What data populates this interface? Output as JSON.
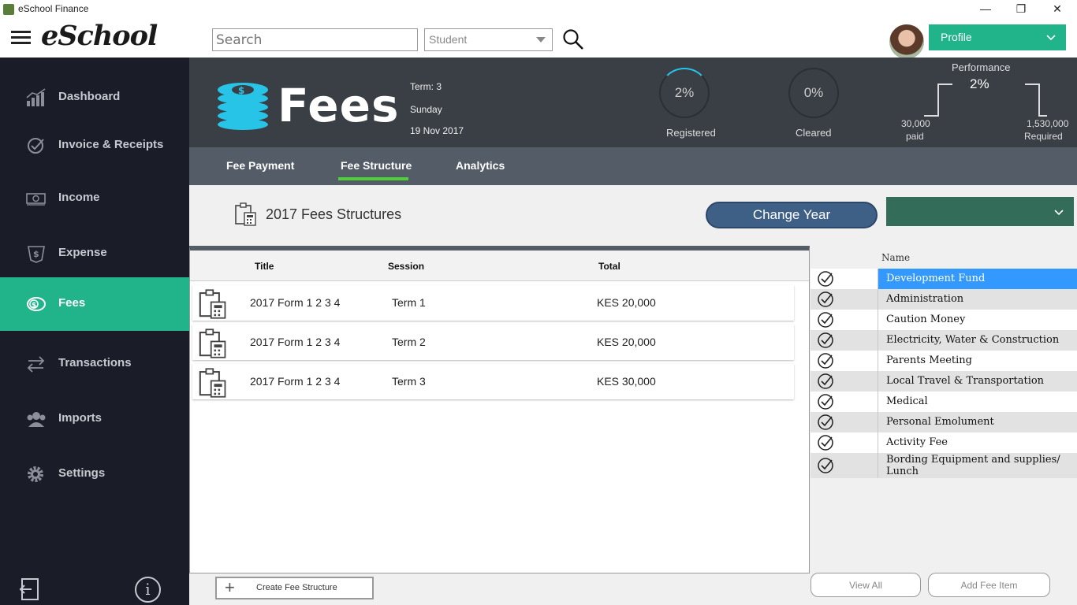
{
  "window": {
    "title": "eSchool Finance",
    "minimize": "—",
    "maximize": "❐",
    "close": "✕"
  },
  "header": {
    "logo": "eSchool",
    "search_placeholder": "Search",
    "filter_value": "Student",
    "profile_label": "Profile"
  },
  "sidebar": {
    "items": [
      {
        "label": "Dashboard",
        "icon": "chart-icon"
      },
      {
        "label": "Invoice & Receipts",
        "icon": "check-circle-icon"
      },
      {
        "label": "Income",
        "icon": "money-icon"
      },
      {
        "label": "Expense",
        "icon": "expense-icon"
      },
      {
        "label": "Fees",
        "icon": "coins-icon"
      },
      {
        "label": "Transactions",
        "icon": "transfer-arrows-icon"
      },
      {
        "label": "Imports",
        "icon": "users-icon"
      },
      {
        "label": "Settings",
        "icon": "gear-icon"
      }
    ],
    "active": "Fees",
    "info": "i"
  },
  "banner": {
    "title": "Fees",
    "term": "Term: 3",
    "day": "Sunday",
    "date": "19 Nov 2017",
    "registered_value": "2%",
    "registered_label": "Registered",
    "cleared_value": "0%",
    "cleared_label": "Cleared",
    "performance_label": "Performance",
    "performance_value": "2%",
    "paid_amount": "30,000",
    "paid_label": "paid",
    "required_amount": "1,530,000",
    "required_label": "Required"
  },
  "tabs": [
    {
      "label": "Fee Payment"
    },
    {
      "label": "Fee Structure"
    },
    {
      "label": "Analytics"
    }
  ],
  "active_tab": "Fee Structure",
  "structures": {
    "title": "2017 Fees Structures",
    "change_year": "Change Year",
    "columns": {
      "title": "Title",
      "session": "Session",
      "total": "Total"
    },
    "rows": [
      {
        "title": "2017 Form 1 2 3 4",
        "session": "Term 1",
        "total": "KES 20,000"
      },
      {
        "title": "2017 Form 1 2 3 4",
        "session": "Term 2",
        "total": "KES 20,000"
      },
      {
        "title": "2017 Form 1 2 3 4",
        "session": "Term 3",
        "total": "KES 30,000"
      }
    ],
    "create_button": "Create Fee Structure"
  },
  "fee_items": {
    "column": "Name",
    "items": [
      "Development Fund",
      "Administration",
      "Caution Money",
      "Electricity, Water & Construction",
      "Parents Meeting",
      "Local Travel & Transportation",
      "Medical",
      "Personal Emolument",
      "Activity Fee",
      "Bording Equipment and supplies/ Lunch"
    ],
    "selected": "Development Fund",
    "view_all": "View All",
    "add_item": "Add Fee Item"
  },
  "colors": {
    "accent": "#21b38a",
    "sidebar": "#1a1c27",
    "banner": "#393f45",
    "tabbar": "#545c67",
    "selection": "#3399ff",
    "change_year": "#3e5f86"
  }
}
